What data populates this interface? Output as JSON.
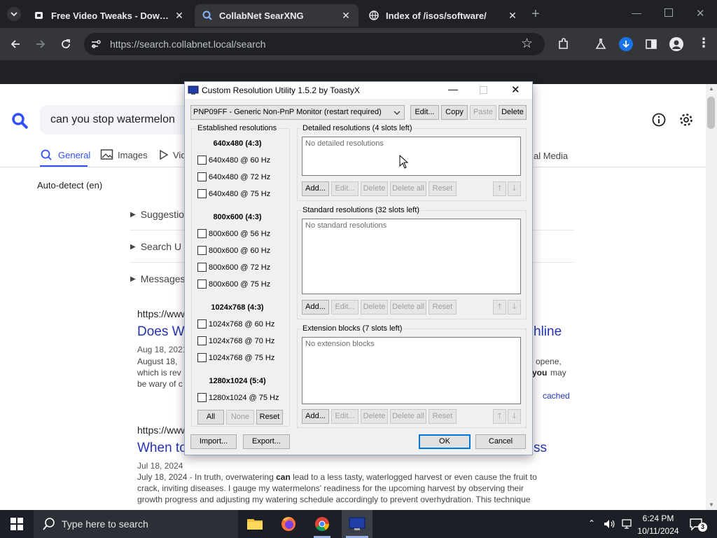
{
  "browser": {
    "tabs": [
      {
        "title": "Free Video Tweaks - Download"
      },
      {
        "title": "CollabNet SearXNG"
      },
      {
        "title": "Index of /isos/software/"
      }
    ],
    "url": "https://search.collabnet.local/search"
  },
  "search": {
    "query": "can you stop watermelon",
    "tabs": [
      "General",
      "Images",
      "Vid",
      "al Media"
    ],
    "language": "Auto-detect (en)",
    "collapsibles": [
      "Suggestio",
      "Search U",
      "Messages"
    ],
    "results": [
      {
        "url": "https://www",
        "title": "Does W",
        "title_tail": "hline",
        "date": "Aug 18, 2021",
        "snippet1": "August 18,",
        "snippet1_tail": "opene,",
        "snippet2": "which is rev",
        "snippet2_bold": "you",
        "snippet2_tail": "may",
        "snippet3": "be wary of c",
        "cached": "cached"
      },
      {
        "url": "https://www",
        "title": "When to",
        "title_tail": "ss",
        "date": "Jul 18, 2024",
        "lines": [
          [
            "July 18, 2024 - In truth, overwatering ",
            "can",
            " lead to a less tasty, waterlogged harvest or even cause the fruit to"
          ],
          [
            "crack, inviting diseases. I gauge my watermelons' readiness for the upcoming harvest by observing their",
            "",
            ""
          ],
          [
            "growth progress and adjusting my watering schedule accordingly to prevent overhydration. This technique",
            "",
            ""
          ]
        ]
      }
    ]
  },
  "dialog": {
    "title": "Custom Resolution Utility 1.5.2 by ToastyX",
    "monitor": "PNP09FF - Generic Non-PnP Monitor (restart required)",
    "top_buttons": {
      "edit": "Edit...",
      "copy": "Copy",
      "paste": "Paste",
      "delete": "Delete"
    },
    "established": {
      "label": "Established resolutions",
      "groups": [
        {
          "header": "640x480 (4:3)",
          "items": [
            "640x480 @ 60 Hz",
            "640x480 @ 72 Hz",
            "640x480 @ 75 Hz"
          ]
        },
        {
          "header": "800x600 (4:3)",
          "items": [
            "800x600 @ 56 Hz",
            "800x600 @ 60 Hz",
            "800x600 @ 72 Hz",
            "800x600 @ 75 Hz"
          ]
        },
        {
          "header": "1024x768 (4:3)",
          "items": [
            "1024x768 @ 60 Hz",
            "1024x768 @ 70 Hz",
            "1024x768 @ 75 Hz"
          ]
        },
        {
          "header": "1280x1024 (5:4)",
          "items": [
            "1280x1024 @ 75 Hz"
          ]
        }
      ],
      "buttons": {
        "all": "All",
        "none": "None",
        "reset": "Reset"
      }
    },
    "sections": [
      {
        "label": "Detailed resolutions (4 slots left)",
        "empty": "No detailed resolutions"
      },
      {
        "label": "Standard resolutions (32 slots left)",
        "empty": "No standard resolutions"
      },
      {
        "label": "Extension blocks (7 slots left)",
        "empty": "No extension blocks"
      }
    ],
    "row_buttons": {
      "add": "Add...",
      "edit": "Edit...",
      "delete": "Delete",
      "delete_all": "Delete all",
      "reset": "Reset"
    },
    "bottom_buttons": {
      "import": "Import...",
      "export": "Export...",
      "ok": "OK",
      "cancel": "Cancel"
    }
  },
  "taskbar": {
    "search_placeholder": "Type here to search",
    "time": "6:24 PM",
    "date": "10/11/2024",
    "notifications": "3"
  }
}
